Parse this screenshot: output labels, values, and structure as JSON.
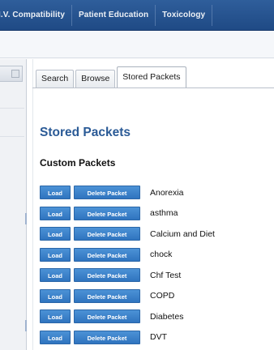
{
  "topnav": {
    "items": [
      "I.V. Compatibility",
      "Patient Education",
      "Toxicology"
    ]
  },
  "tabs": [
    {
      "label": "Search",
      "active": false
    },
    {
      "label": "Browse",
      "active": false
    },
    {
      "label": "Stored Packets",
      "active": true
    }
  ],
  "main": {
    "title": "Stored Packets",
    "section_title": "Custom Packets",
    "load_label": "Load",
    "delete_label": "Delete Packet",
    "packets": [
      "Anorexia",
      "asthma",
      "Calcium and Diet",
      "chock",
      "Chf Test",
      "COPD",
      "Diabetes",
      "DVT"
    ]
  },
  "colors": {
    "nav_bg": "#1f4a85",
    "accent_title": "#2a5a96",
    "button_bg": "#2f74bf"
  }
}
